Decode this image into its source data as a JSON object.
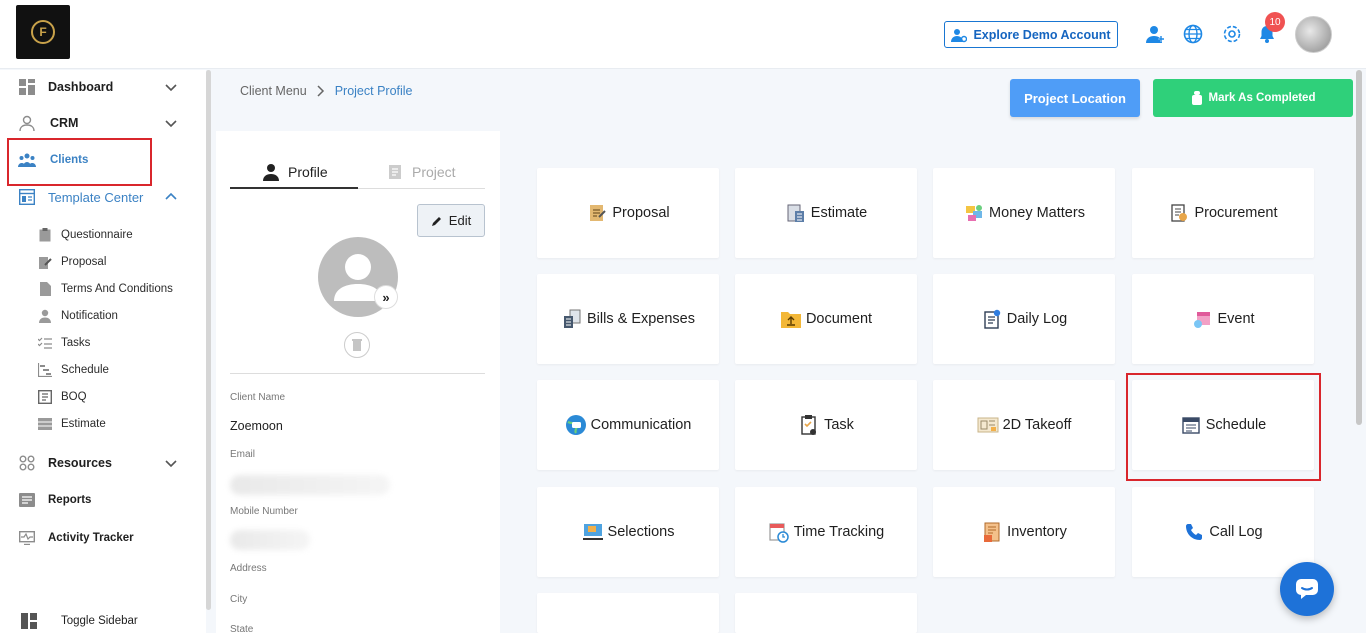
{
  "header": {
    "demo_button": "Explore Demo Account",
    "notification_count": "10"
  },
  "sidebar": {
    "items": [
      {
        "label": "Dashboard"
      },
      {
        "label": "CRM"
      },
      {
        "label": "Clients"
      },
      {
        "label": "Template Center"
      },
      {
        "label": "Resources"
      },
      {
        "label": "Reports"
      },
      {
        "label": "Activity Tracker"
      }
    ],
    "template_sub": [
      {
        "label": "Questionnaire"
      },
      {
        "label": "Proposal"
      },
      {
        "label": "Terms And Conditions"
      },
      {
        "label": "Notification"
      },
      {
        "label": "Tasks"
      },
      {
        "label": "Schedule"
      },
      {
        "label": "BOQ"
      },
      {
        "label": "Estimate"
      }
    ],
    "toggle": "Toggle Sidebar"
  },
  "breadcrumb": {
    "parent": "Client Menu",
    "current": "Project Profile"
  },
  "actions": {
    "location": "Project Location",
    "completed": "Mark As Completed"
  },
  "profile": {
    "tab_profile": "Profile",
    "tab_project": "Project",
    "edit": "Edit",
    "fields": {
      "client_name_label": "Client Name",
      "client_name_value": "Zoemoon",
      "email_label": "Email",
      "mobile_label": "Mobile Number",
      "address_label": "Address",
      "city_label": "City",
      "state_label": "State"
    }
  },
  "cards": [
    {
      "label": "Proposal"
    },
    {
      "label": "Estimate"
    },
    {
      "label": "Money Matters"
    },
    {
      "label": "Procurement"
    },
    {
      "label": "Bills & Expenses"
    },
    {
      "label": "Document"
    },
    {
      "label": "Daily Log"
    },
    {
      "label": "Event"
    },
    {
      "label": "Communication"
    },
    {
      "label": "Task"
    },
    {
      "label": "2D Takeoff"
    },
    {
      "label": "Schedule"
    },
    {
      "label": "Selections"
    },
    {
      "label": "Time Tracking"
    },
    {
      "label": "Inventory"
    },
    {
      "label": "Call Log"
    }
  ],
  "colors": {
    "accent": "#3b82c4",
    "primary_button": "#4f9df7",
    "success_button": "#2fd07a",
    "highlight": "#d9262c"
  }
}
